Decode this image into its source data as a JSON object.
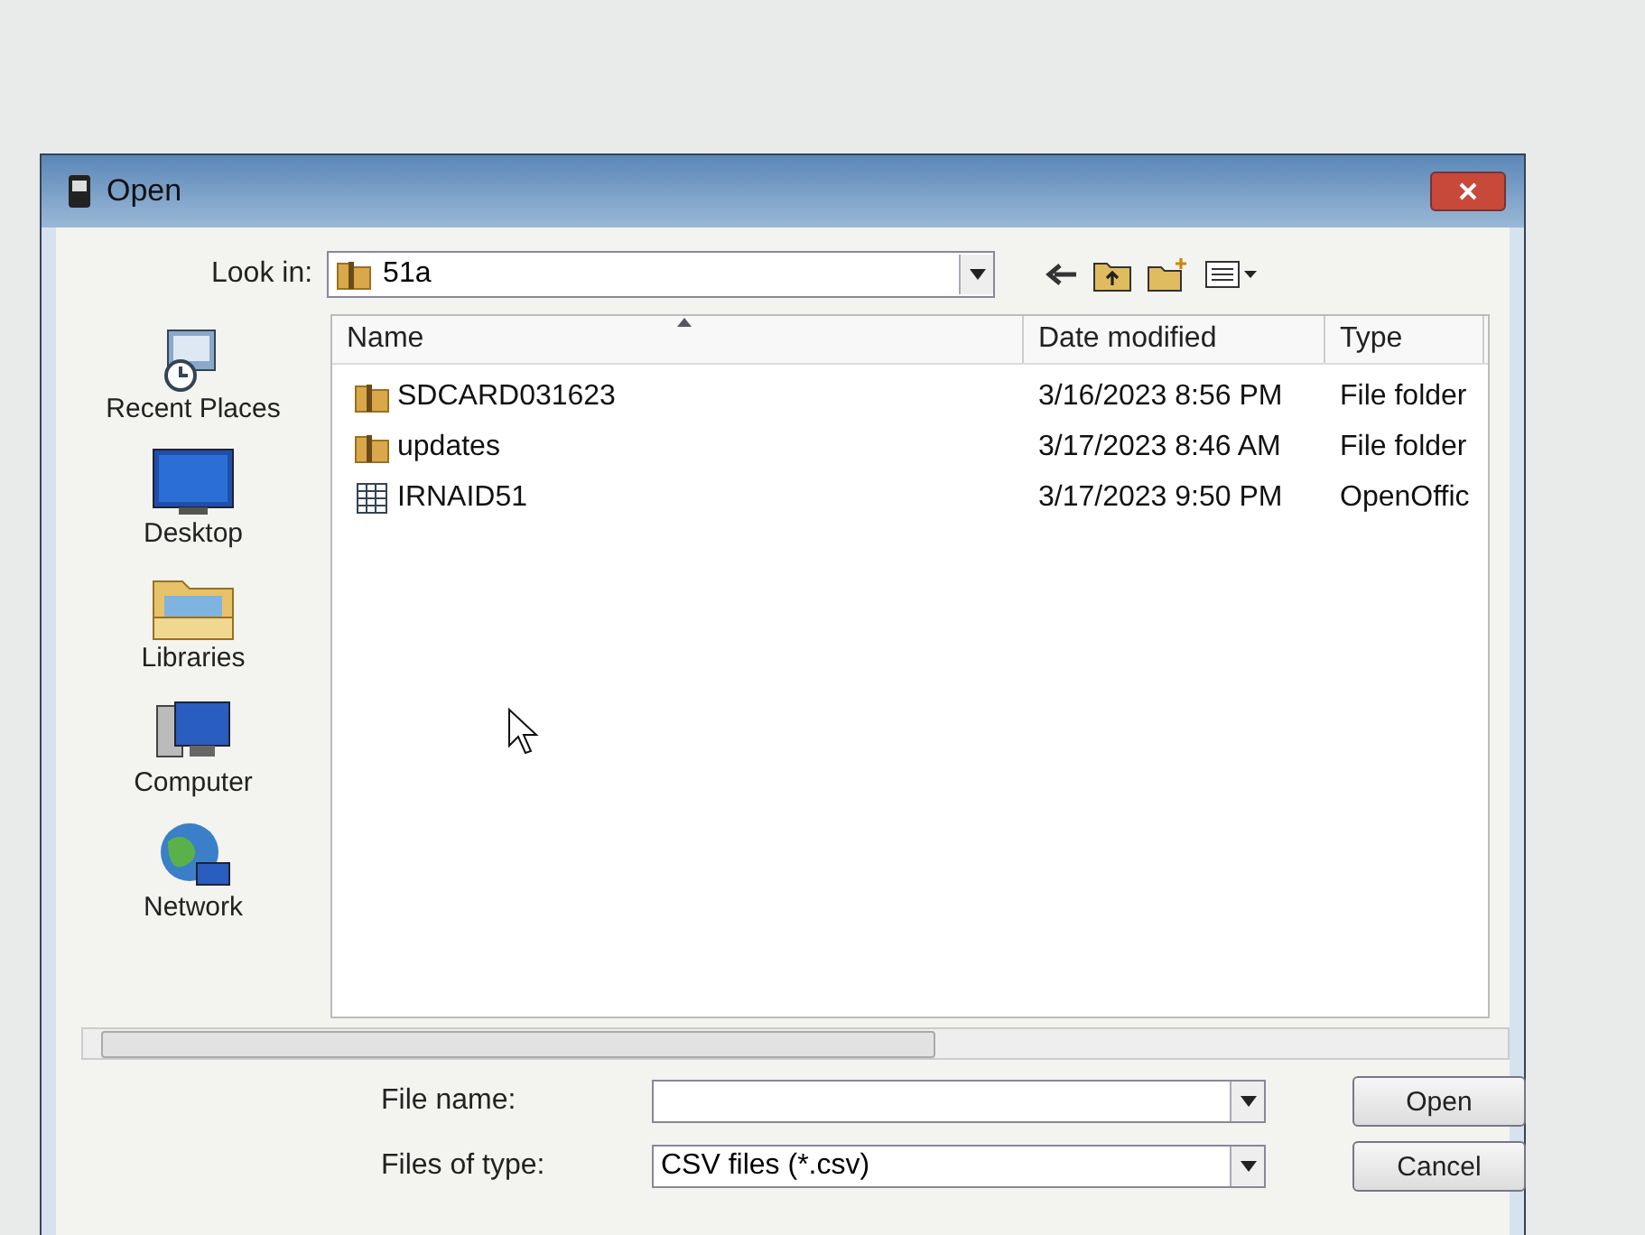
{
  "window": {
    "title": "Open"
  },
  "look_in": {
    "label": "Look in:",
    "value": "51a"
  },
  "places": [
    {
      "kind": "recent",
      "label": "Recent Places"
    },
    {
      "kind": "desktop",
      "label": "Desktop"
    },
    {
      "kind": "libraries",
      "label": "Libraries"
    },
    {
      "kind": "computer",
      "label": "Computer"
    },
    {
      "kind": "network",
      "label": "Network"
    }
  ],
  "file_list": {
    "columns": [
      {
        "label": "Name",
        "sorted": true
      },
      {
        "label": "Date modified",
        "sorted": false
      },
      {
        "label": "Type",
        "sorted": false
      }
    ],
    "rows": [
      {
        "kind": "folder",
        "name": "SDCARD031623",
        "date": "3/16/2023 8:56 PM",
        "type": "File folder"
      },
      {
        "kind": "folder",
        "name": "updates",
        "date": "3/17/2023 8:46 AM",
        "type": "File folder"
      },
      {
        "kind": "sheet",
        "name": "IRNAID51",
        "date": "3/17/2023 9:50 PM",
        "type": "OpenOffic"
      }
    ]
  },
  "file_name": {
    "label": "File name:"
  },
  "file_type": {
    "label": "Files of type:",
    "value": "CSV files (*.csv)"
  },
  "buttons": [
    "Open",
    "Cancel"
  ]
}
